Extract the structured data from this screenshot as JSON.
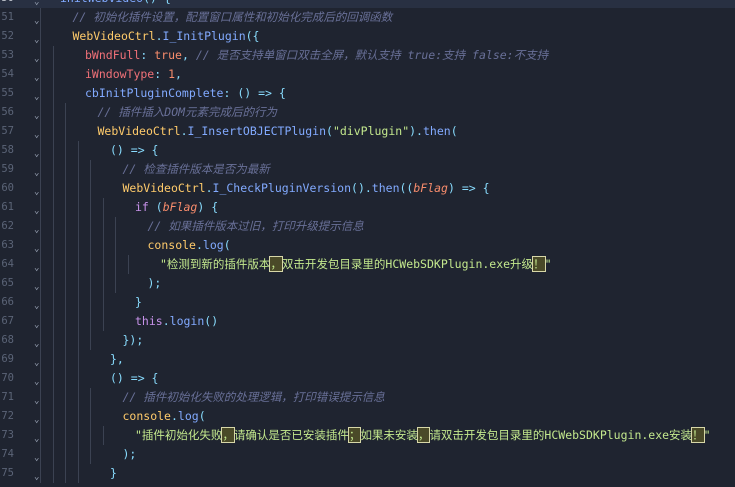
{
  "editor": {
    "lines": [
      {
        "number": "50",
        "indent": 0,
        "tokens": [
          [
            "initWebvideo",
            "fn"
          ],
          [
            "() {",
            "punc"
          ]
        ]
      },
      {
        "number": "51",
        "indent": 1,
        "tokens": [
          [
            "// 初始化插件设置，配置窗口属性和初始化完成后的回调函数",
            "com"
          ]
        ]
      },
      {
        "number": "52",
        "indent": 1,
        "tokens": [
          [
            "WebVideoCtrl",
            "obj"
          ],
          [
            ".",
            "punc"
          ],
          [
            "I_InitPlugin",
            "fn"
          ],
          [
            "({",
            "punc"
          ]
        ]
      },
      {
        "number": "53",
        "indent": 2,
        "tokens": [
          [
            "bWndFull",
            "prop"
          ],
          [
            ": ",
            "punc"
          ],
          [
            "true",
            "num"
          ],
          [
            ", ",
            "punc"
          ],
          [
            "// 是否支持单窗口双击全屏，默认支持 true:支持 false:不支持",
            "com"
          ]
        ]
      },
      {
        "number": "54",
        "indent": 2,
        "tokens": [
          [
            "iWndowType",
            "prop"
          ],
          [
            ": ",
            "punc"
          ],
          [
            "1",
            "num"
          ],
          [
            ",",
            "punc"
          ]
        ]
      },
      {
        "number": "55",
        "indent": 2,
        "tokens": [
          [
            "cbInitPluginComplete",
            "fn"
          ],
          [
            ": () => {",
            "punc"
          ]
        ]
      },
      {
        "number": "56",
        "indent": 3,
        "tokens": [
          [
            "// 插件插入DOM元素完成后的行为",
            "com"
          ]
        ]
      },
      {
        "number": "57",
        "indent": 3,
        "tokens": [
          [
            "WebVideoCtrl",
            "obj"
          ],
          [
            ".",
            "punc"
          ],
          [
            "I_InsertOBJECTPlugin",
            "fn"
          ],
          [
            "(",
            "punc"
          ],
          [
            "\"divPlugin\"",
            "str"
          ],
          [
            ").",
            "punc"
          ],
          [
            "then",
            "fn"
          ],
          [
            "(",
            "punc"
          ]
        ]
      },
      {
        "number": "58",
        "indent": 4,
        "tokens": [
          [
            "() => {",
            "punc"
          ]
        ]
      },
      {
        "number": "59",
        "indent": 5,
        "tokens": [
          [
            "// 检查插件版本是否为最新",
            "com"
          ]
        ]
      },
      {
        "number": "60",
        "indent": 5,
        "tokens": [
          [
            "WebVideoCtrl",
            "obj"
          ],
          [
            ".",
            "punc"
          ],
          [
            "I_CheckPluginVersion",
            "fn"
          ],
          [
            "().",
            "punc"
          ],
          [
            "then",
            "fn"
          ],
          [
            "((",
            "punc"
          ],
          [
            "bFlag",
            "param"
          ],
          [
            ") => {",
            "punc"
          ]
        ]
      },
      {
        "number": "61",
        "indent": 6,
        "tokens": [
          [
            "if",
            "kw"
          ],
          [
            " (",
            "punc"
          ],
          [
            "bFlag",
            "param"
          ],
          [
            ") {",
            "punc"
          ]
        ]
      },
      {
        "number": "62",
        "indent": 7,
        "tokens": [
          [
            "// 如果插件版本过旧，打印升级提示信息",
            "com"
          ]
        ]
      },
      {
        "number": "63",
        "indent": 7,
        "tokens": [
          [
            "console",
            "obj"
          ],
          [
            ".",
            "punc"
          ],
          [
            "log",
            "fn"
          ],
          [
            "(",
            "punc"
          ]
        ]
      },
      {
        "number": "64",
        "indent": 8,
        "tokens": [
          [
            "\"检测到新的插件版本",
            "str"
          ],
          [
            "，",
            "ch"
          ],
          [
            "双击开发包目录里的HCWebSDKPlugin.exe升级",
            "str"
          ],
          [
            "！",
            "ch"
          ],
          [
            "\"",
            "str"
          ]
        ]
      },
      {
        "number": "65",
        "indent": 7,
        "tokens": [
          [
            ");",
            "punc"
          ]
        ]
      },
      {
        "number": "66",
        "indent": 6,
        "tokens": [
          [
            "}",
            "punc"
          ]
        ]
      },
      {
        "number": "67",
        "indent": 6,
        "tokens": [
          [
            "this",
            "kw"
          ],
          [
            ".",
            "punc"
          ],
          [
            "login",
            "fn"
          ],
          [
            "()",
            "punc"
          ]
        ]
      },
      {
        "number": "68",
        "indent": 5,
        "tokens": [
          [
            "});",
            "punc"
          ]
        ]
      },
      {
        "number": "69",
        "indent": 4,
        "tokens": [
          [
            "},",
            "punc"
          ]
        ]
      },
      {
        "number": "70",
        "indent": 4,
        "tokens": [
          [
            "() => {",
            "punc"
          ]
        ]
      },
      {
        "number": "71",
        "indent": 5,
        "tokens": [
          [
            "// 插件初始化失败的处理逻辑，打印错误提示信息",
            "com"
          ]
        ]
      },
      {
        "number": "72",
        "indent": 5,
        "tokens": [
          [
            "console",
            "obj"
          ],
          [
            ".",
            "punc"
          ],
          [
            "log",
            "fn"
          ],
          [
            "(",
            "punc"
          ]
        ]
      },
      {
        "number": "73",
        "indent": 6,
        "tokens": [
          [
            "\"插件初始化失败",
            "str"
          ],
          [
            "，",
            "ch"
          ],
          [
            "请确认是否已安装插件",
            "str"
          ],
          [
            "；",
            "ch"
          ],
          [
            "如果未安装",
            "str"
          ],
          [
            "，",
            "ch"
          ],
          [
            "请双击开发包目录里的HCWebSDKPlugin.exe安装",
            "str"
          ],
          [
            "！",
            "ch"
          ],
          [
            "\"",
            "str"
          ]
        ]
      },
      {
        "number": "74",
        "indent": 5,
        "tokens": [
          [
            ");",
            "punc"
          ]
        ]
      },
      {
        "number": "75",
        "indent": 4,
        "tokens": [
          [
            "}",
            "punc"
          ]
        ]
      }
    ]
  }
}
